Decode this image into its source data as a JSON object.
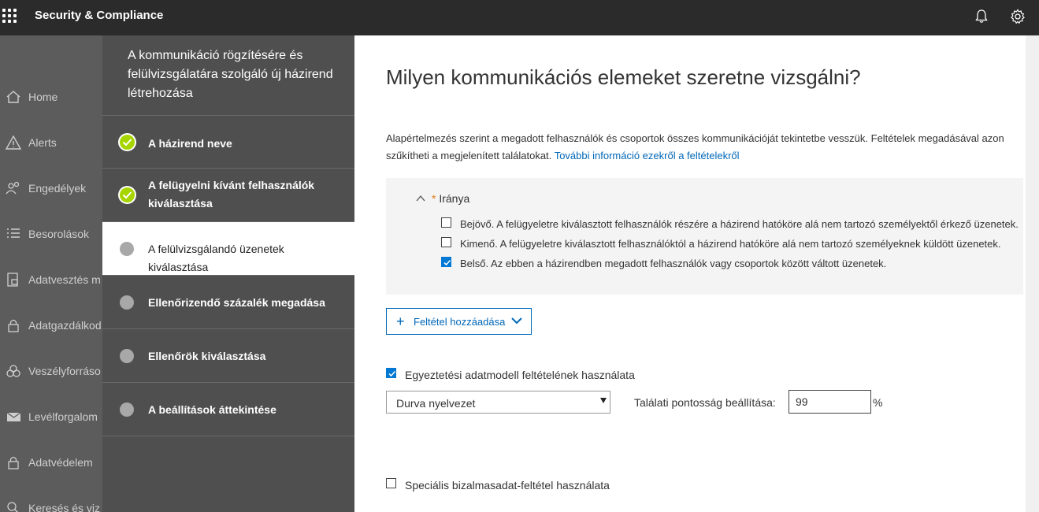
{
  "topbar": {
    "app_title": "Security & Compliance"
  },
  "nav": {
    "items": [
      {
        "label": "Home",
        "icon": "home-icon"
      },
      {
        "label": "Alerts",
        "icon": "alert-icon"
      },
      {
        "label": "Engedélyek",
        "icon": "people-icon"
      },
      {
        "label": "Besorolások",
        "icon": "list-icon"
      },
      {
        "label": "Adatvesztés m",
        "icon": "lock-doc-icon"
      },
      {
        "label": "Adatgazdálkod",
        "icon": "lock-icon"
      },
      {
        "label": "Veszélyforráso",
        "icon": "biohazard-icon"
      },
      {
        "label": "Levélforgalom",
        "icon": "mail-icon"
      },
      {
        "label": "Adatvédelem",
        "icon": "lock-icon"
      },
      {
        "label": "Keresés és viz",
        "icon": "search-icon"
      }
    ]
  },
  "wizard": {
    "title": "A kommunikáció rögzítésére és felülvizsgálatára szolgáló új házirend létrehozása",
    "steps": [
      {
        "label": "A házirend neve",
        "state": "done"
      },
      {
        "label": "A felügyelni kívánt felhasználók kiválasztása",
        "state": "done"
      },
      {
        "label": "A felülvizsgálandó üzenetek kiválasztása",
        "state": "active"
      },
      {
        "label": "Ellenőrizendő százalék megadása",
        "state": "pending"
      },
      {
        "label": "Ellenőrök kiválasztása",
        "state": "pending"
      },
      {
        "label": "A beállítások áttekintése",
        "state": "pending"
      }
    ]
  },
  "main": {
    "heading": "Milyen kommunikációs elemeket szeretne vizsgálni?",
    "description": "Alapértelmezés szerint a megadott felhasználók és csoportok összes kommunikációját tekintetbe vesszük. Feltételek megadásával azon",
    "description_line2": "szűkítheti a megjelenített találatokat.",
    "more_info_link": "További információ ezekről a feltételekről",
    "condition": {
      "required_mark": "*",
      "title": "Iránya",
      "options": [
        {
          "label": "Bejövő. A felügyeletre kiválasztott felhasználók részére a házirend hatóköre alá nem tartozó személyektől érkező üzenetek.",
          "checked": false
        },
        {
          "label": "Kimenő. A felügyeletre kiválasztott felhasználóktól a házirend hatóköre alá nem tartozó személyeknek küldött üzenetek.",
          "checked": false
        },
        {
          "label": "Belső. Az ebben a házirendben megadott felhasználók vagy csoportok között váltott üzenetek.",
          "checked": true
        }
      ]
    },
    "add_condition_label": "Feltétel hozzáadása",
    "model_condition": {
      "label": "Egyeztetési adatmodell feltételének használata",
      "checked": true
    },
    "model_select_value": "Durva nyelvezet",
    "accuracy_label": "Találati pontosság beállítása:",
    "accuracy_value": "99",
    "accuracy_unit": "%",
    "sensitive_condition": {
      "label": "Speciális bizalmasadat-feltétel használata",
      "checked": false
    }
  },
  "colors": {
    "topbar": "#2b2b2b",
    "nav": "#5c5c5c",
    "wizard": "#4f4f4f",
    "check": "#a7d500",
    "accent": "#0078d4",
    "link": "#0067b8"
  }
}
